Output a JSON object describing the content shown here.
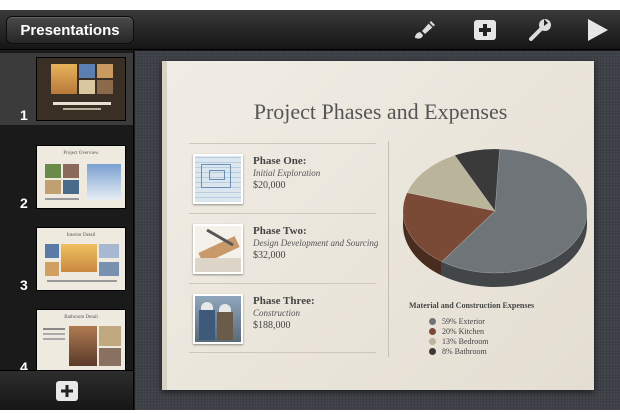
{
  "toolbar": {
    "back_label": "Presentations",
    "icons": [
      "paintbrush-icon",
      "add-icon",
      "wrench-icon",
      "play-icon"
    ]
  },
  "sidebar": {
    "slides": [
      {
        "number": "1",
        "thumb_title": "",
        "selected": true
      },
      {
        "number": "2",
        "thumb_title": "Project Overview",
        "selected": false
      },
      {
        "number": "3",
        "thumb_title": "Interior Detail",
        "selected": false
      },
      {
        "number": "4",
        "thumb_title": "Bathroom Detail",
        "selected": false
      }
    ],
    "add_icon": "add-slide-icon"
  },
  "slide": {
    "title": "Project Phases and Expenses",
    "phases": [
      {
        "name": "Phase One:",
        "description": "Initial Exploration",
        "cost": "$20,000"
      },
      {
        "name": "Phase Two:",
        "description": "Design Development and Sourcing",
        "cost": "$32,000"
      },
      {
        "name": "Phase Three:",
        "description": "Construction",
        "cost": "$188,000"
      }
    ]
  },
  "chart_data": {
    "type": "pie",
    "title": "Material and Construction Expenses",
    "slices": [
      {
        "label": "59% Exterior",
        "value": 59,
        "color": "#6f7478"
      },
      {
        "label": "20% Kitchen",
        "value": 20,
        "color": "#7a4a36"
      },
      {
        "label": "13% Bedroom",
        "value": 13,
        "color": "#b9b49a"
      },
      {
        "label": "8% Bathroom",
        "value": 8,
        "color": "#3a3a3a"
      }
    ]
  }
}
